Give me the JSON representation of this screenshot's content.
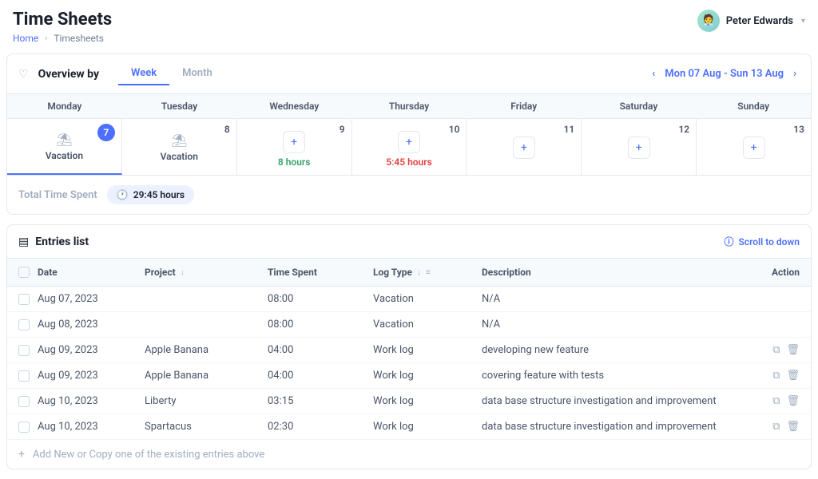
{
  "header": {
    "title": "Time Sheets",
    "user_name": "Peter Edwards"
  },
  "breadcrumb": {
    "home": "Home",
    "current": "Timesheets"
  },
  "overview": {
    "title": "Overview by",
    "tabs": {
      "week": "Week",
      "month": "Month"
    },
    "date_range": "Mon 07 Aug - Sun 13 Aug",
    "total_label": "Total Time Spent",
    "total_value": "29:45 hours"
  },
  "days": [
    {
      "head": "Monday",
      "num": "7",
      "type": "vacation",
      "label": "Vacation",
      "selected": true
    },
    {
      "head": "Tuesday",
      "num": "8",
      "type": "vacation",
      "label": "Vacation",
      "selected": false
    },
    {
      "head": "Wednesday",
      "num": "9",
      "type": "add",
      "hours": "8 hours",
      "hours_color": "green"
    },
    {
      "head": "Thursday",
      "num": "10",
      "type": "add",
      "hours": "5:45 hours",
      "hours_color": "red"
    },
    {
      "head": "Friday",
      "num": "11",
      "type": "add"
    },
    {
      "head": "Saturday",
      "num": "12",
      "type": "add"
    },
    {
      "head": "Sunday",
      "num": "13",
      "type": "add"
    }
  ],
  "entries": {
    "title": "Entries list",
    "scroll_label": "Scroll to down",
    "columns": {
      "date": "Date",
      "project": "Project",
      "time": "Time Spent",
      "log": "Log Type",
      "desc": "Description",
      "action": "Action"
    },
    "rows": [
      {
        "date": "Aug 07, 2023",
        "project": "",
        "time": "08:00",
        "log": "Vacation",
        "desc": "N/A",
        "actions": false
      },
      {
        "date": "Aug 08, 2023",
        "project": "",
        "time": "08:00",
        "log": "Vacation",
        "desc": "N/A",
        "actions": false
      },
      {
        "date": "Aug 09, 2023",
        "project": "Apple Banana",
        "time": "04:00",
        "log": "Work log",
        "desc": "developing new feature",
        "actions": true
      },
      {
        "date": "Aug 09, 2023",
        "project": "Apple Banana",
        "time": "04:00",
        "log": "Work log",
        "desc": "covering feature with tests",
        "actions": true
      },
      {
        "date": "Aug 10, 2023",
        "project": "Liberty",
        "time": "03:15",
        "log": "Work log",
        "desc": "data base structure investigation and improvement",
        "actions": true
      },
      {
        "date": "Aug 10, 2023",
        "project": "Spartacus",
        "time": "02:30",
        "log": "Work log",
        "desc": "data base structure investigation and improvement",
        "actions": true
      }
    ],
    "add_hint": "Add New or Copy one of the existing entries above"
  }
}
